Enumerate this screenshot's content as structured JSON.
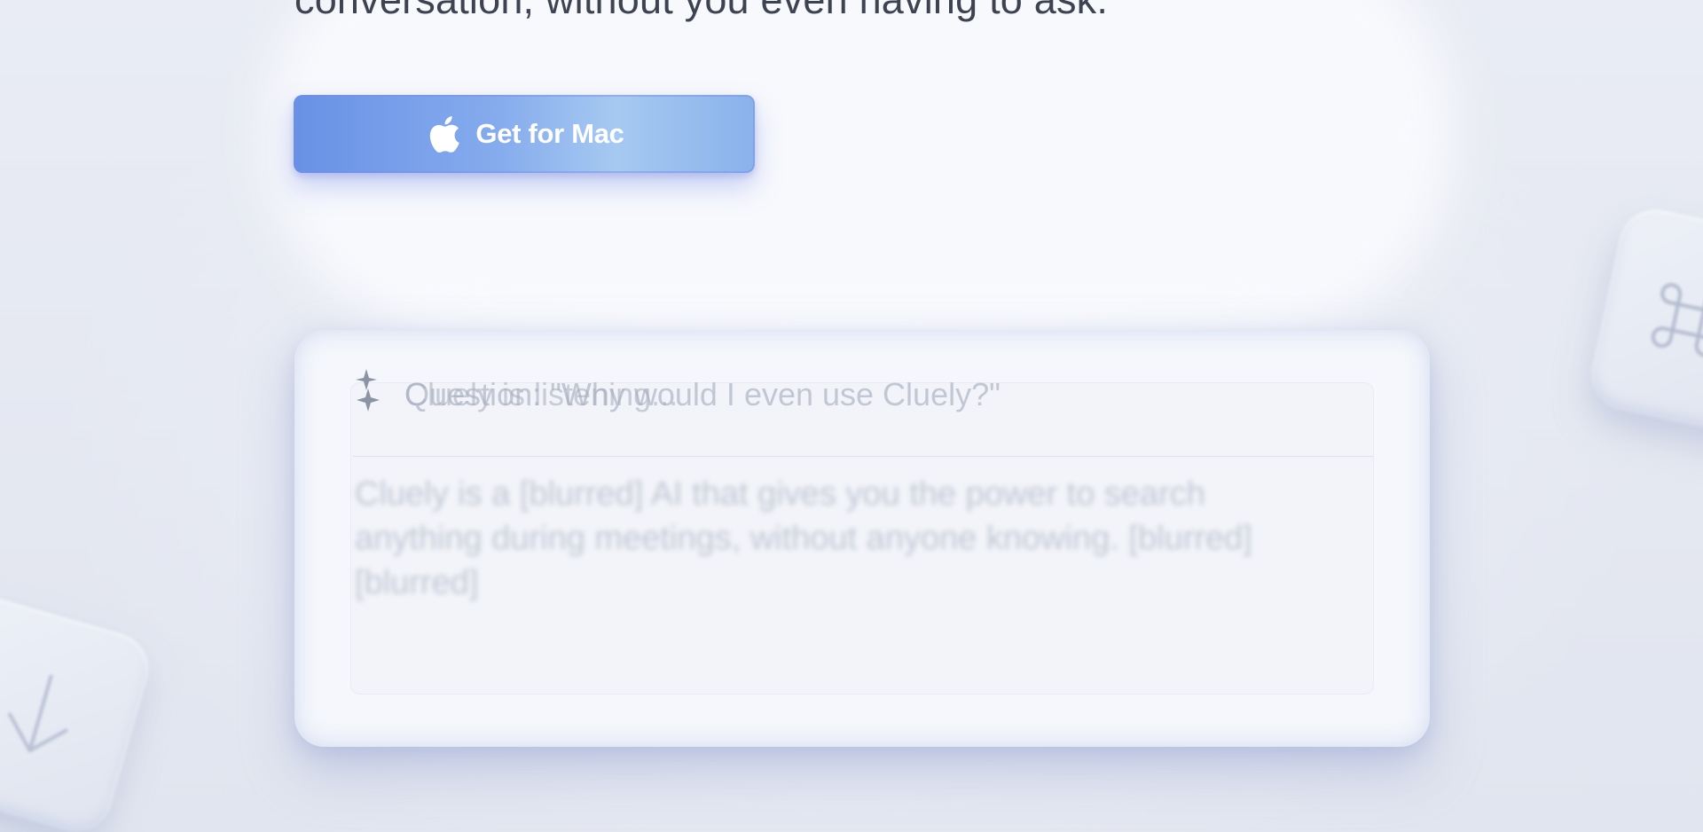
{
  "hero": {
    "headline": "conversation, without you even having to ask."
  },
  "cta": {
    "label": "Get for Mac",
    "icon": "apple-icon"
  },
  "demo_panel": {
    "status": "Cluely is listening...",
    "question": "Question: \"Why would I even use Cluely?\"",
    "answer": "Cluely is a [blurred] AI that gives you the power to search anything during meetings, without anyone knowing. [blurred] [blurred]",
    "icon": "sparkle-icon"
  },
  "decorative_keys": [
    {
      "icon": "arrow-down-icon"
    },
    {
      "icon": "command-key-icon"
    }
  ],
  "colors": {
    "cta_gradient_start": "#6891e6",
    "cta_gradient_end": "#a6c9f1",
    "background": "#e3e7f1",
    "headline": "#3e4351"
  }
}
